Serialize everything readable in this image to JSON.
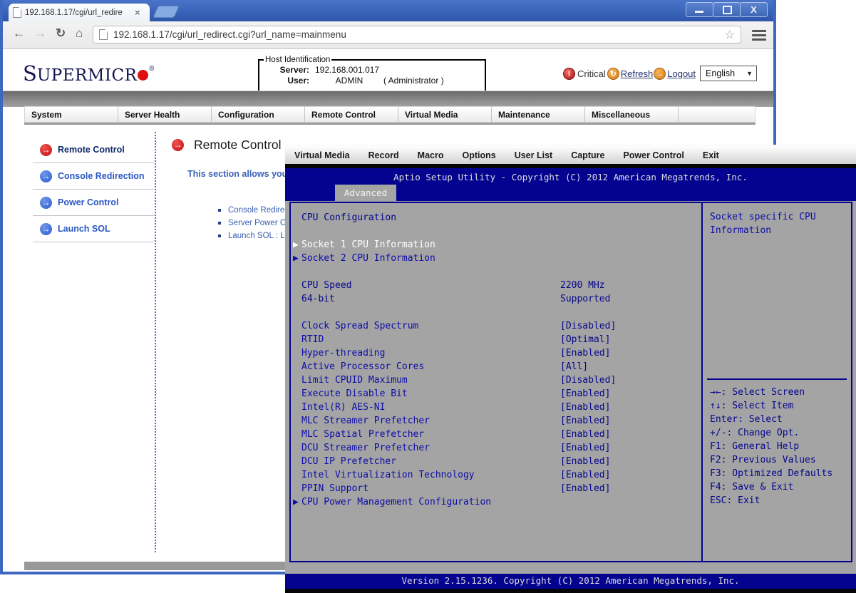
{
  "icons": {
    "star": "☆",
    "back": "←",
    "forward": "→",
    "refresh": "↻",
    "home": "⌂",
    "dropdown": "▼",
    "side_arrow": "→",
    "submenu": "▶",
    "critical_mark": "!",
    "tab_close": "×",
    "logout_arrow": "→"
  },
  "browser": {
    "tab_title": "192.168.1.17/cgi/url_redire",
    "url": "192.168.1.17/cgi/url_redirect.cgi?url_name=mainmenu"
  },
  "header": {
    "logo_first": "S",
    "logo_rest": "UPERMICR",
    "logo_reg": "®",
    "host_identification": {
      "legend": "Host Identification",
      "server_label": "Server:",
      "server_value": "192.168.001.017",
      "user_label": "User:",
      "user_value": "ADMIN",
      "user_role": "( Administrator )"
    },
    "status": {
      "critical_label": "Critical",
      "refresh_label": "Refresh",
      "logout_label": "Logout",
      "language": "English"
    }
  },
  "nav": {
    "items": [
      "System",
      "Server Health",
      "Configuration",
      "Remote Control",
      "Virtual Media",
      "Maintenance",
      "Miscellaneous"
    ]
  },
  "sidebar": {
    "items": [
      {
        "label": "Remote Control",
        "active": true
      },
      {
        "label": "Console Redirection",
        "active": false
      },
      {
        "label": "Power Control",
        "active": false
      },
      {
        "label": "Launch SOL",
        "active": false
      }
    ]
  },
  "content": {
    "title": "Remote Control",
    "intro": "This section allows you t",
    "bullets": [
      "Console Redirection",
      "Server Power Contr",
      "Launch SOL : Laun"
    ]
  },
  "console": {
    "menu_items": [
      "Virtual Media",
      "Record",
      "Macro",
      "Options",
      "User List",
      "Capture",
      "Power Control",
      "Exit"
    ],
    "bios": {
      "title": "Aptio Setup Utility - Copyright (C) 2012 American Megatrends, Inc.",
      "tab": "Advanced",
      "rows": [
        {
          "label": "CPU Configuration",
          "style": "info"
        },
        {
          "blank": true
        },
        {
          "label": "Socket 1 CPU Information",
          "style": "selected",
          "arrow": true
        },
        {
          "label": "Socket 2 CPU Information",
          "style": "link",
          "arrow": true
        },
        {
          "blank": true
        },
        {
          "label": "CPU Speed",
          "value": "2200 MHz",
          "style": "info"
        },
        {
          "label": "64-bit",
          "value": "Supported",
          "style": "info"
        },
        {
          "blank": true
        },
        {
          "label": "Clock Spread Spectrum",
          "value": "[Disabled]",
          "style": "link"
        },
        {
          "label": "RTID",
          "value": "[Optimal]",
          "style": "link"
        },
        {
          "label": "Hyper-threading",
          "value": "[Enabled]",
          "style": "link"
        },
        {
          "label": "Active Processor Cores",
          "value": "[All]",
          "style": "link"
        },
        {
          "label": "Limit CPUID Maximum",
          "value": "[Disabled]",
          "style": "link"
        },
        {
          "label": "Execute Disable Bit",
          "value": "[Enabled]",
          "style": "link"
        },
        {
          "label": "Intel(R) AES-NI",
          "value": "[Enabled]",
          "style": "link"
        },
        {
          "label": "MLC Streamer Prefetcher",
          "value": "[Enabled]",
          "style": "link"
        },
        {
          "label": "MLC Spatial Prefetcher",
          "value": "[Enabled]",
          "style": "link"
        },
        {
          "label": "DCU Streamer Prefetcher",
          "value": "[Enabled]",
          "style": "link"
        },
        {
          "label": "DCU IP Prefetcher",
          "value": "[Enabled]",
          "style": "link"
        },
        {
          "label": "Intel Virtualization Technology",
          "value": "[Enabled]",
          "style": "link"
        },
        {
          "label": "PPIN Support",
          "value": "[Enabled]",
          "style": "link"
        },
        {
          "label": "CPU Power Management Configuration",
          "style": "link",
          "arrow": true
        }
      ],
      "help_title": "Socket specific CPU Information",
      "keys": [
        "→←: Select Screen",
        "↑↓: Select Item",
        "Enter: Select",
        "+/-: Change Opt.",
        "F1: General Help",
        "F2: Previous Values",
        "F3: Optimized Defaults",
        "F4: Save & Exit",
        "ESC: Exit"
      ],
      "version": "Version 2.15.1236. Copyright (C) 2012 American Megatrends, Inc."
    }
  }
}
